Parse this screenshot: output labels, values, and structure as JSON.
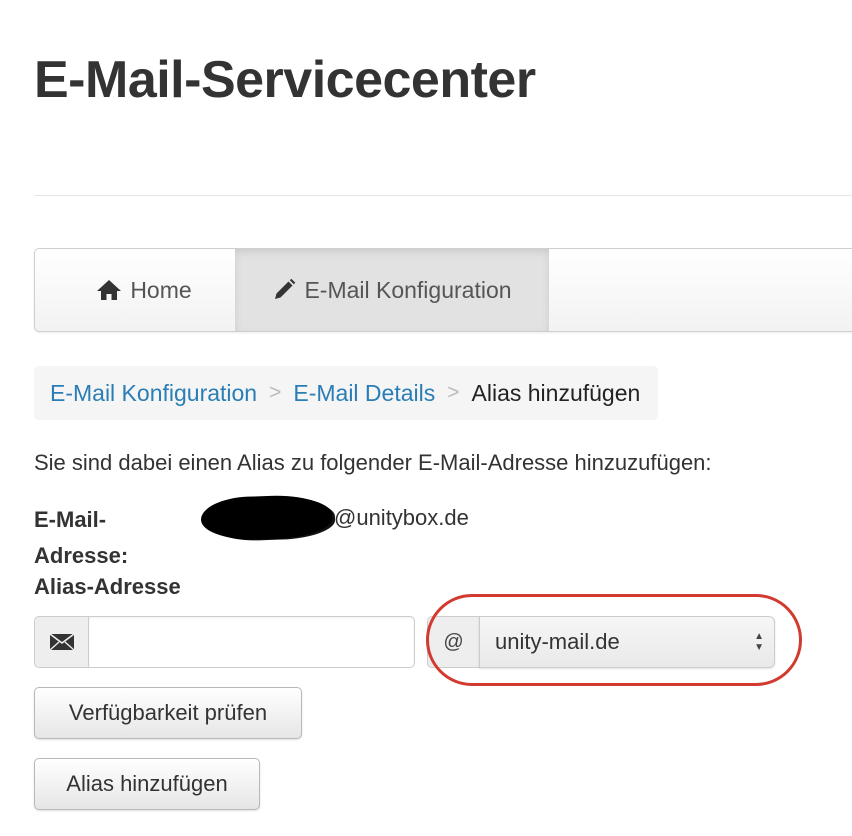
{
  "page": {
    "title": "E-Mail-Servicecenter"
  },
  "navbar": {
    "items": [
      {
        "label": "Home",
        "icon": "home-icon",
        "active": false
      },
      {
        "label": "E-Mail Konfiguration",
        "icon": "pencil-icon",
        "active": true
      }
    ]
  },
  "breadcrumb": {
    "items": [
      {
        "label": "E-Mail Konfiguration",
        "link": true
      },
      {
        "label": "E-Mail Details",
        "link": true
      },
      {
        "label": "Alias hinzufügen",
        "link": false
      }
    ],
    "separator": ">"
  },
  "form": {
    "intro": "Sie sind dabei einen Alias zu folgender E-Mail-Adresse hinzuzufügen:",
    "email_label": "E-Mail-Adresse:",
    "email_label_line1": "E-Mail-",
    "email_label_line2": "Adresse:",
    "email_value_domain": "@unitybox.de",
    "alias_label": "Alias-Adresse",
    "alias_input_value": "",
    "alias_input_icon": "envelope-icon",
    "at_symbol": "@",
    "domain_select_value": "unity-mail.de",
    "check_button": "Verfügbarkeit prüfen",
    "add_button": "Alias hinzufügen"
  },
  "colors": {
    "link": "#2a7db5",
    "highlight_ring": "#d23a30",
    "title": "#333333"
  }
}
